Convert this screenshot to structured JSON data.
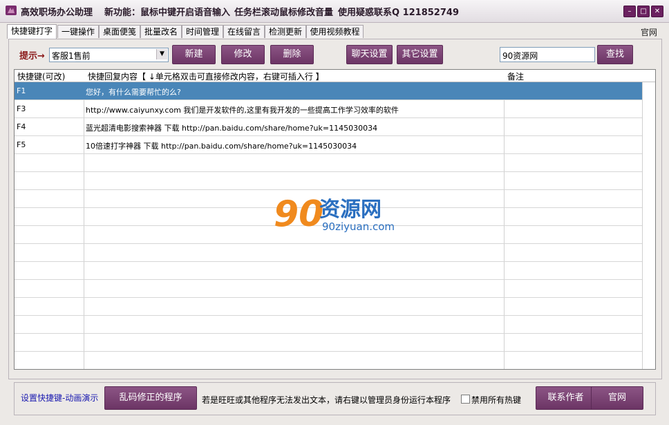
{
  "titlebar": {
    "app_title": "高效职场办公助理",
    "feature": "新功能：鼠标中键开启语音输入",
    "taskbar_tip": "任务栏滚动鼠标修改音量",
    "contact": "使用疑惑联系Q  121852749",
    "min": "–",
    "max": "□",
    "close": "✕"
  },
  "tabs": [
    "快捷键打字",
    "一键操作",
    "桌面便笺",
    "批量改名",
    "时间管理",
    "在线留言",
    "检测更新",
    "使用视频教程"
  ],
  "header_link": "官网",
  "toolbar": {
    "hint_label": "提示→",
    "select_value": "客服1售前",
    "buttons": [
      "新建",
      "修改",
      "删除",
      "聊天设置",
      "其它设置"
    ],
    "search_value": "90资源网",
    "search_button": "查找"
  },
  "table": {
    "columns": [
      "快捷键(可改)",
      "快捷回复内容【 ↓单元格双击可直接修改内容，右键可插入行 】",
      "备注"
    ],
    "rows": [
      {
        "key": "F1",
        "content": "您好，有什么需要帮忙的么?",
        "note": ""
      },
      {
        "key": "F3",
        "content": "http://www.caiyunxy.com  我们是开发软件的,这里有我开发的一些提高工作学习效率的软件",
        "note": ""
      },
      {
        "key": "F4",
        "content": "蓝光超清电影搜索神器 下载 http://pan.baidu.com/share/home?uk=1145030034",
        "note": ""
      },
      {
        "key": "F5",
        "content": "10倍速打字神器 下载 http://pan.baidu.com/share/home?uk=1145030034",
        "note": ""
      }
    ]
  },
  "watermark": {
    "brand": "资源网",
    "logo_digits": "90",
    "url": "90ziyuan.com"
  },
  "bottom": {
    "demo_link": "设置快捷键-动画演示",
    "fix_button": "乱码修正的程序",
    "note": "若是旺旺或其他程序无法发出文本，请右键以管理员身份运行本程序",
    "disable_hotkeys": "禁用所有热键",
    "contact_button": "联系作者",
    "site_button": "官网"
  },
  "colors": {
    "accent": "#6c3565",
    "selected_row": "#4a86b8",
    "watermark_orange": "#f08a1e",
    "watermark_blue": "#2a6fc0"
  }
}
